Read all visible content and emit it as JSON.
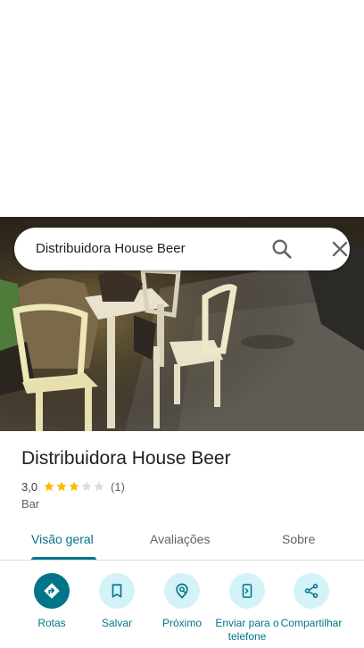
{
  "search": {
    "query": "Distribuidora House Beer",
    "search_icon": "search-icon",
    "close_icon": "close-icon"
  },
  "photo": {
    "description_icon": "place-photo"
  },
  "place": {
    "name": "Distribuidora House Beer",
    "rating": "3,0",
    "rating_stars": 3,
    "rating_max": 5,
    "review_count": "(1)",
    "category": "Bar"
  },
  "tabs": [
    {
      "label": "Visão geral",
      "active": true
    },
    {
      "label": "Avaliações",
      "active": false
    },
    {
      "label": "Sobre",
      "active": false
    }
  ],
  "actions": [
    {
      "label": "Rotas",
      "icon": "directions-icon"
    },
    {
      "label": "Salvar",
      "icon": "bookmark-icon"
    },
    {
      "label": "Próximo",
      "icon": "nearby-icon"
    },
    {
      "label": "Enviar para o telefone",
      "icon": "send-to-phone-icon"
    },
    {
      "label": "Compartilhar",
      "icon": "share-icon"
    }
  ],
  "colors": {
    "accent": "#00758a",
    "accent_light": "#d3f3f8",
    "star_filled": "#fbbc04",
    "star_empty": "#dadce0"
  }
}
